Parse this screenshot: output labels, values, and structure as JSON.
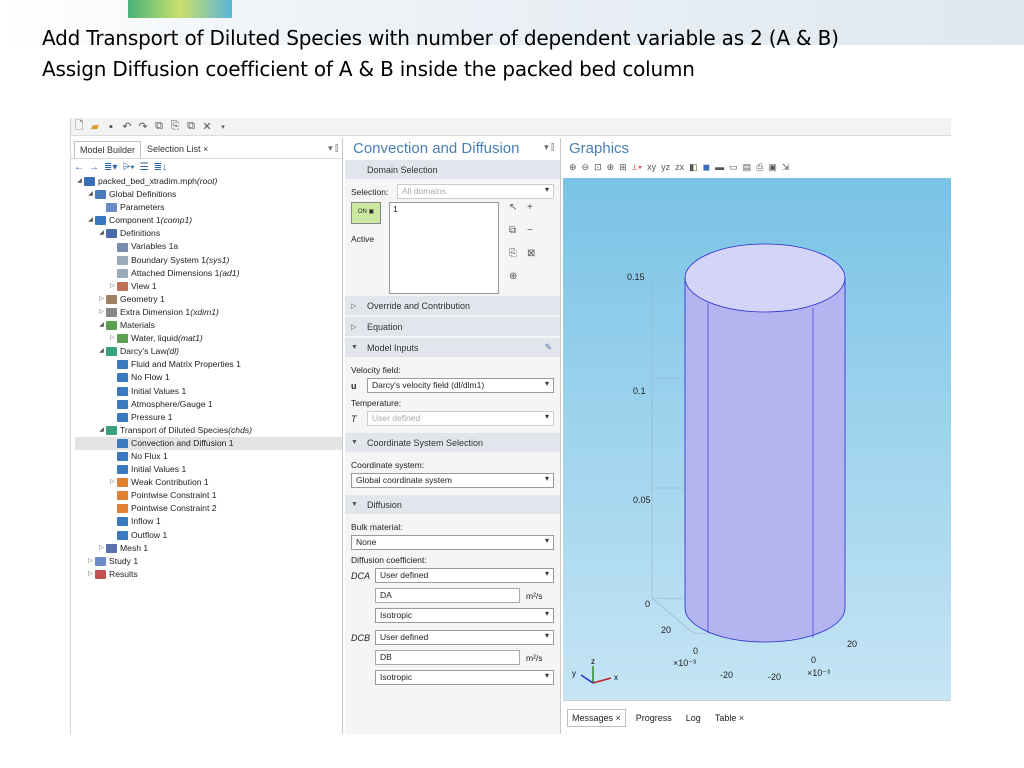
{
  "slide": {
    "line1": "Add Transport of Diluted Species with number of dependent variable as 2 (A & B)",
    "line2": "Assign Diffusion coefficient of A & B inside the packed bed column"
  },
  "model_builder": {
    "tabs": [
      "Model Builder",
      "Selection List ×"
    ],
    "tree": [
      {
        "lvl": 0,
        "exp": "◢",
        "label": "packed_bed_xtradim.mph",
        "sub": " (root)",
        "color": "#3a6fb5"
      },
      {
        "lvl": 1,
        "exp": "◢",
        "label": "Global Definitions",
        "sub": "",
        "color": "#4a7ab8"
      },
      {
        "lvl": 2,
        "exp": "",
        "label": "Parameters",
        "sub": "",
        "color": "#6a8ac8"
      },
      {
        "lvl": 1,
        "exp": "◢",
        "label": "Component 1",
        "sub": " (comp1)",
        "color": "#3a78c0"
      },
      {
        "lvl": 2,
        "exp": "◢",
        "label": "Definitions",
        "sub": "",
        "color": "#4a6aa8"
      },
      {
        "lvl": 3,
        "exp": "",
        "label": "Variables 1a",
        "sub": "",
        "color": "#7a8ab0"
      },
      {
        "lvl": 3,
        "exp": "",
        "label": "Boundary System 1",
        "sub": " (sys1)",
        "color": "#9ab"
      },
      {
        "lvl": 3,
        "exp": "",
        "label": "Attached Dimensions 1",
        "sub": " (ad1)",
        "color": "#9ab"
      },
      {
        "lvl": 3,
        "exp": "▷",
        "label": "View 1",
        "sub": "",
        "color": "#c07050"
      },
      {
        "lvl": 2,
        "exp": "▷",
        "label": "Geometry 1",
        "sub": "",
        "color": "#a08060"
      },
      {
        "lvl": 2,
        "exp": "▷",
        "label": "Extra Dimension 1",
        "sub": " (xdim1)",
        "color": "#888"
      },
      {
        "lvl": 2,
        "exp": "◢",
        "label": "Materials",
        "sub": "",
        "color": "#5aa050"
      },
      {
        "lvl": 3,
        "exp": "▷",
        "label": "Water, liquid",
        "sub": " (mat1)",
        "color": "#5aa050"
      },
      {
        "lvl": 2,
        "exp": "◢",
        "label": "Darcy's Law",
        "sub": " (dl)",
        "color": "#3aa080"
      },
      {
        "lvl": 3,
        "exp": "",
        "label": "Fluid and Matrix Properties 1",
        "sub": "",
        "color": "#3a78c0"
      },
      {
        "lvl": 3,
        "exp": "",
        "label": "No Flow 1",
        "sub": "",
        "color": "#3a78c0"
      },
      {
        "lvl": 3,
        "exp": "",
        "label": "Initial Values 1",
        "sub": "",
        "color": "#3a78c0"
      },
      {
        "lvl": 3,
        "exp": "",
        "label": "Atmosphere/Gauge 1",
        "sub": "",
        "color": "#3a78c0"
      },
      {
        "lvl": 3,
        "exp": "",
        "label": "Pressure 1",
        "sub": "",
        "color": "#3a78c0"
      },
      {
        "lvl": 2,
        "exp": "◢",
        "label": "Transport of Diluted Species",
        "sub": " (chds)",
        "color": "#3aa080"
      },
      {
        "lvl": 3,
        "exp": "",
        "label": "Convection and Diffusion 1",
        "sub": "",
        "color": "#3a78c0",
        "sel": true
      },
      {
        "lvl": 3,
        "exp": "",
        "label": "No Flux 1",
        "sub": "",
        "color": "#3a78c0"
      },
      {
        "lvl": 3,
        "exp": "",
        "label": "Initial Values 1",
        "sub": "",
        "color": "#3a78c0"
      },
      {
        "lvl": 3,
        "exp": "▷",
        "label": "Weak Contribution 1",
        "sub": "",
        "color": "#e08030"
      },
      {
        "lvl": 3,
        "exp": "",
        "label": "Pointwise Constraint 1",
        "sub": "",
        "color": "#e08030"
      },
      {
        "lvl": 3,
        "exp": "",
        "label": "Pointwise Constraint 2",
        "sub": "",
        "color": "#e08030"
      },
      {
        "lvl": 3,
        "exp": "",
        "label": "Inflow 1",
        "sub": "",
        "color": "#3a78c0"
      },
      {
        "lvl": 3,
        "exp": "",
        "label": "Outflow 1",
        "sub": "",
        "color": "#3a78c0"
      },
      {
        "lvl": 2,
        "exp": "▷",
        "label": "Mesh 1",
        "sub": "",
        "color": "#5a70b0"
      },
      {
        "lvl": 1,
        "exp": "▷",
        "label": "Study 1",
        "sub": "",
        "color": "#6a8ac8"
      },
      {
        "lvl": 1,
        "exp": "▷",
        "label": "Results",
        "sub": "",
        "color": "#c05050"
      }
    ]
  },
  "settings": {
    "title": "Convection and Diffusion",
    "domain_selection": "Domain Selection",
    "selection_label": "Selection:",
    "selection_value": "All domains",
    "list_item": "1",
    "active": "Active",
    "override": "Override and Contribution",
    "equation": "Equation",
    "model_inputs": "Model Inputs",
    "velocity_label": "Velocity field:",
    "velocity_sym": "u",
    "velocity_value": "Darcy's velocity field (dl/dlm1)",
    "temperature_label": "Temperature:",
    "temperature_sym": "T",
    "temperature_value": "User defined",
    "coord_section": "Coordinate System Selection",
    "coord_label": "Coordinate system:",
    "coord_value": "Global coordinate system",
    "diffusion": "Diffusion",
    "bulk_label": "Bulk material:",
    "bulk_value": "None",
    "diffcoef_label": "Diffusion coefficient:",
    "dca_sym": "DCA",
    "dca_value": "User defined",
    "dca_text": "DA",
    "dca_unit": "m²/s",
    "dca_iso": "Isotropic",
    "dcb_sym": "DCB",
    "dcb_value": "User defined",
    "dcb_text": "DB",
    "dcb_unit": "m²/s",
    "dcb_iso": "Isotropic"
  },
  "graphics": {
    "title": "Graphics",
    "zlabels": [
      "0.15",
      "0.1",
      "0.05",
      "0"
    ],
    "xticks": [
      "20",
      "0",
      "-20"
    ],
    "yticks": [
      "20",
      "0",
      "-20"
    ],
    "scale_left": "×10⁻³",
    "scale_right": "×10⁻³",
    "axes": {
      "x": "x",
      "y": "y",
      "z": "z"
    }
  },
  "messages": {
    "tabs": [
      "Messages ×",
      "Progress",
      "Log",
      "Table ×"
    ]
  }
}
